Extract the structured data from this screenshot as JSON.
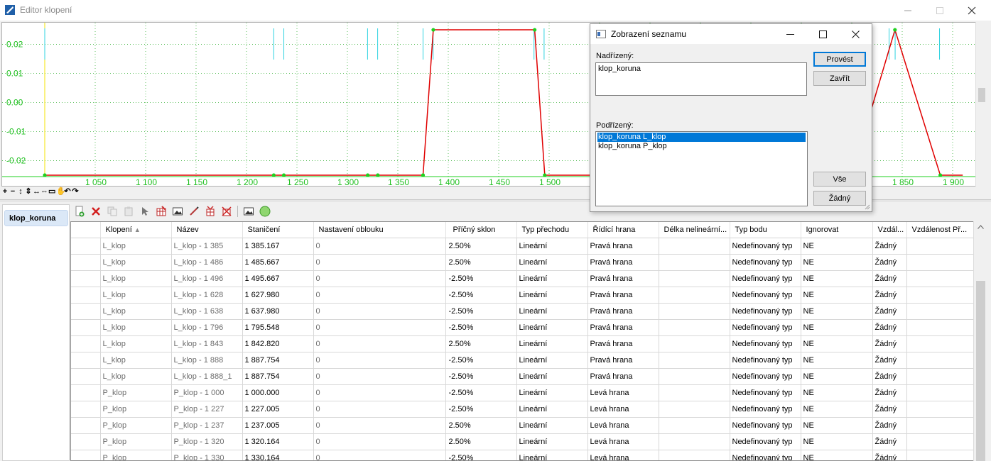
{
  "window": {
    "title": "Editor klopení"
  },
  "chart_data": {
    "type": "line",
    "title": "",
    "xlabel": "",
    "ylabel": "",
    "xlim": [
      1000,
      1910
    ],
    "ylim": [
      -0.0255,
      0.0255
    ],
    "y_ticks": [
      0.02,
      0.01,
      0.0,
      -0.01,
      -0.02
    ],
    "y_tick_labels": [
      "0.02",
      "0.01",
      "0.00",
      "-0.01",
      "-0.02"
    ],
    "x_ticks": [
      1050,
      1100,
      1150,
      1200,
      1250,
      1300,
      1350,
      1400,
      1450,
      1500,
      1850,
      1900
    ],
    "x_tick_labels": [
      "1 050",
      "1 100",
      "1 150",
      "1 200",
      "1 250",
      "1 300",
      "1 350",
      "1 400",
      "1 450",
      "1 500",
      "1 850",
      "1 900"
    ],
    "grid": true,
    "series": [
      {
        "color": "#e00000",
        "x": [
          1000,
          1227.005,
          1237.005,
          1320.164,
          1330.164,
          1375.0,
          1385.167,
          1485.667,
          1495.667,
          1800.0,
          1842.82,
          1887.754,
          1910
        ],
        "y": [
          -0.025,
          -0.025,
          -0.025,
          -0.025,
          -0.025,
          -0.025,
          0.025,
          0.025,
          -0.025,
          -0.025,
          0.025,
          -0.025,
          -0.025
        ]
      }
    ],
    "markers_cyan": [
      1000,
      1227,
      1237,
      1320,
      1330,
      1375,
      1385,
      1485,
      1495,
      1837,
      1843,
      1887
    ],
    "cursor_line_x": 1000
  },
  "zoom_toolbar": {
    "icons": [
      "zoom-in-icon",
      "zoom-out-icon",
      "fit-vertical-icon",
      "shrink-vertical-icon",
      "fit-horizontal-icon",
      "shrink-horizontal-icon",
      "zoom-window-icon",
      "pan-icon",
      "undo-icon",
      "redo-icon"
    ]
  },
  "left_panel": {
    "item": "klop_koruna"
  },
  "toolbar": {
    "icons": [
      "add-icon",
      "delete-icon",
      "copy-icon",
      "paste-icon",
      "pick-icon",
      "edit-table-icon",
      "image-icon",
      "draw-icon",
      "filter-icon",
      "remove-filter-icon",
      "picture-icon",
      "circle-icon"
    ]
  },
  "grid": {
    "columns": [
      "Klopení",
      "Název",
      "Staničení",
      "Nastavení oblouku",
      "Příčný sklon",
      "Typ přechodu",
      "Řídící hrana",
      "Délka nelineární...",
      "Typ bodu",
      "Ignorovat",
      "Vzdál...",
      "Vzdálenost Př..."
    ],
    "sort_indicator": "▲",
    "rows": [
      [
        "L_klop",
        "L_klop - 1 385",
        "1 385.167",
        "0",
        "2.50%",
        "Lineární",
        "Pravá hrana",
        "",
        "Nedefinovaný typ",
        "NE",
        "Žádný",
        ""
      ],
      [
        "L_klop",
        "L_klop - 1 486",
        "1 485.667",
        "0",
        "2.50%",
        "Lineární",
        "Pravá hrana",
        "",
        "Nedefinovaný typ",
        "NE",
        "Žádný",
        ""
      ],
      [
        "L_klop",
        "L_klop - 1 496",
        "1 495.667",
        "0",
        "-2.50%",
        "Lineární",
        "Pravá hrana",
        "",
        "Nedefinovaný typ",
        "NE",
        "Žádný",
        ""
      ],
      [
        "L_klop",
        "L_klop - 1 628",
        "1 627.980",
        "0",
        "-2.50%",
        "Lineární",
        "Pravá hrana",
        "",
        "Nedefinovaný typ",
        "NE",
        "Žádný",
        ""
      ],
      [
        "L_klop",
        "L_klop - 1 638",
        "1 637.980",
        "0",
        "-2.50%",
        "Lineární",
        "Pravá hrana",
        "",
        "Nedefinovaný typ",
        "NE",
        "Žádný",
        ""
      ],
      [
        "L_klop",
        "L_klop - 1 796",
        "1 795.548",
        "0",
        "-2.50%",
        "Lineární",
        "Pravá hrana",
        "",
        "Nedefinovaný typ",
        "NE",
        "Žádný",
        ""
      ],
      [
        "L_klop",
        "L_klop - 1 843",
        "1 842.820",
        "0",
        "2.50%",
        "Lineární",
        "Pravá hrana",
        "",
        "Nedefinovaný typ",
        "NE",
        "Žádný",
        ""
      ],
      [
        "L_klop",
        "L_klop - 1 888",
        "1 887.754",
        "0",
        "-2.50%",
        "Lineární",
        "Pravá hrana",
        "",
        "Nedefinovaný typ",
        "NE",
        "Žádný",
        ""
      ],
      [
        "L_klop",
        "L_klop - 1 888_1",
        "1 887.754",
        "0",
        "-2.50%",
        "Lineární",
        "Pravá hrana",
        "",
        "Nedefinovaný typ",
        "NE",
        "Žádný",
        ""
      ],
      [
        "P_klop",
        "P_klop - 1 000",
        "1 000.000",
        "0",
        "-2.50%",
        "Lineární",
        "Levá hrana",
        "",
        "Nedefinovaný typ",
        "NE",
        "Žádný",
        ""
      ],
      [
        "P_klop",
        "P_klop - 1 227",
        "1 227.005",
        "0",
        "-2.50%",
        "Lineární",
        "Levá hrana",
        "",
        "Nedefinovaný typ",
        "NE",
        "Žádný",
        ""
      ],
      [
        "P_klop",
        "P_klop - 1 237",
        "1 237.005",
        "0",
        "2.50%",
        "Lineární",
        "Levá hrana",
        "",
        "Nedefinovaný typ",
        "NE",
        "Žádný",
        ""
      ],
      [
        "P_klop",
        "P_klop - 1 320",
        "1 320.164",
        "0",
        "2.50%",
        "Lineární",
        "Levá hrana",
        "",
        "Nedefinovaný typ",
        "NE",
        "Žádný",
        ""
      ],
      [
        "P_klop",
        "P_klop - 1 330",
        "1 330.164",
        "0",
        "-2.50%",
        "Lineární",
        "Levá hrana",
        "",
        "Nedefinovaný typ",
        "NE",
        "Žádný",
        ""
      ]
    ]
  },
  "dialog": {
    "title": "Zobrazení seznamu",
    "parent_label": "Nadřízený:",
    "parent_value": "klop_koruna",
    "child_label": "Podřízený:",
    "child_items": [
      "klop_koruna L_klop",
      "klop_koruna P_klop"
    ],
    "selected_index": 0,
    "buttons": {
      "execute": "Provést",
      "close": "Zavřít",
      "all": "Vše",
      "none": "Žádný"
    }
  }
}
